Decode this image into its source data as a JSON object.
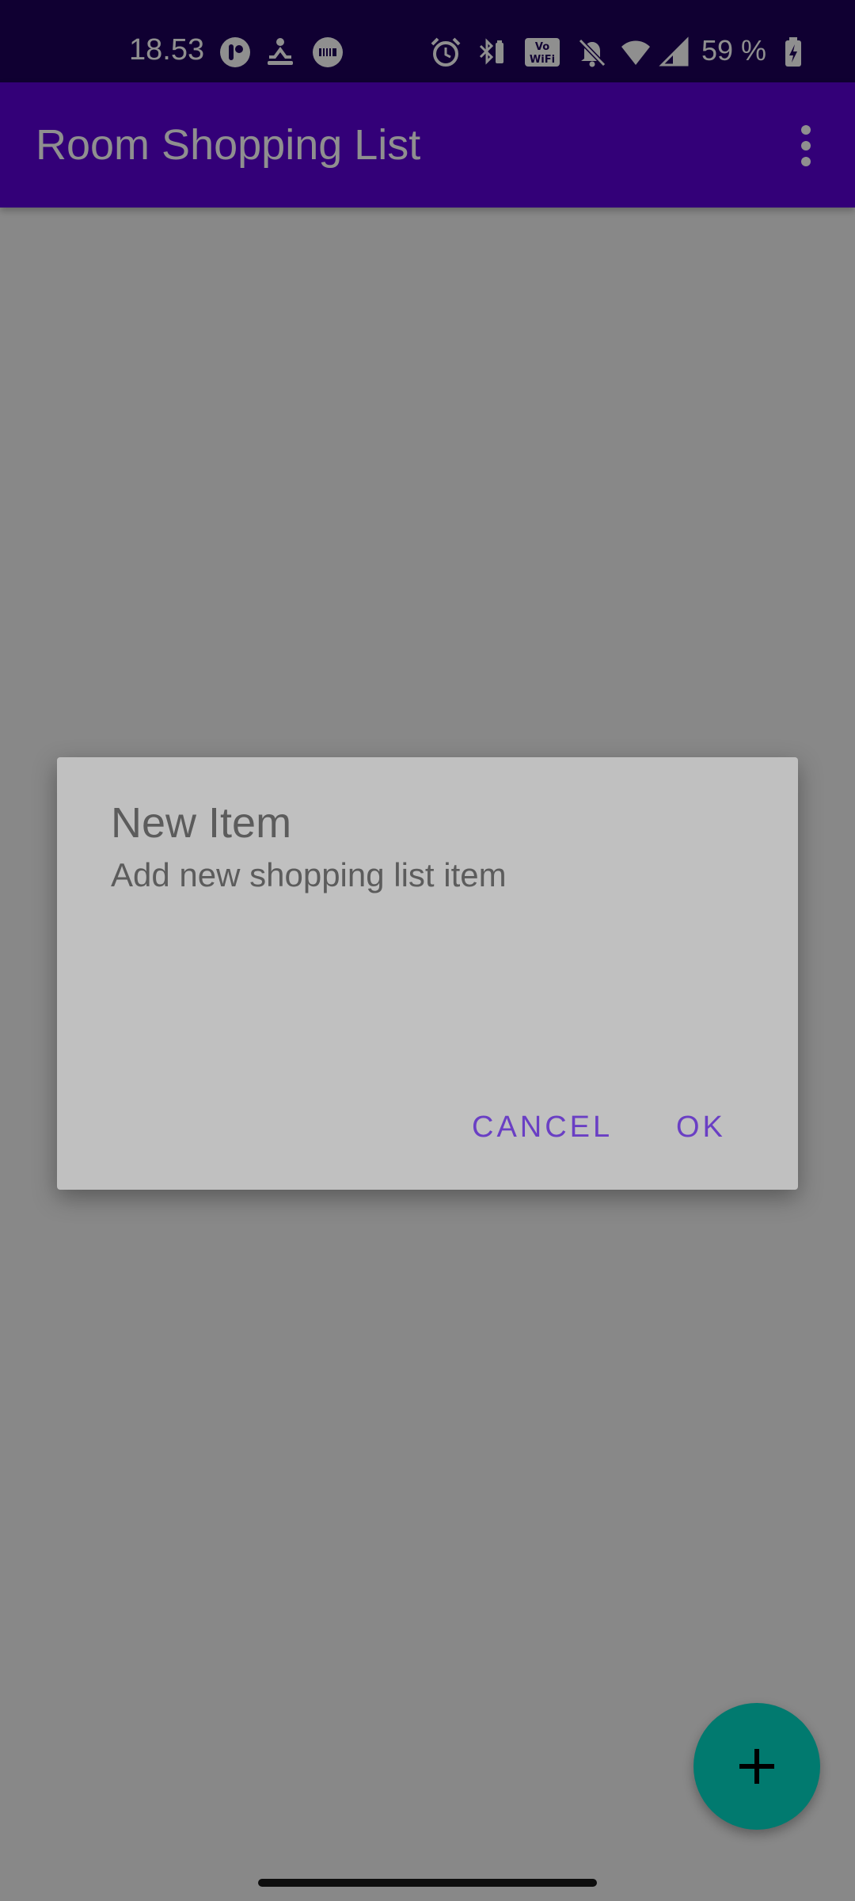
{
  "status_bar": {
    "time": "18.53",
    "battery_percent": "59 %",
    "icons": [
      "notification-app-icon",
      "meditation-icon",
      "battery-saver-icon",
      "alarm-icon",
      "bluetooth-battery-icon",
      "vowifi-icon",
      "muted-bell-icon",
      "wifi-icon",
      "cellular-signal-icon",
      "battery-charging-icon"
    ]
  },
  "app_bar": {
    "title": "Room Shopping List",
    "overflow_icon": "more-vert-icon"
  },
  "dialog": {
    "title": "New Item",
    "message": "Add new shopping list item",
    "cancel_label": "CANCEL",
    "ok_label": "OK"
  },
  "fab": {
    "icon": "plus-icon"
  },
  "colors": {
    "status_bar": "#1d0059",
    "app_bar": "#5b00d6",
    "fab": "#03dac6",
    "dialog_button": "#6a3fc4"
  }
}
